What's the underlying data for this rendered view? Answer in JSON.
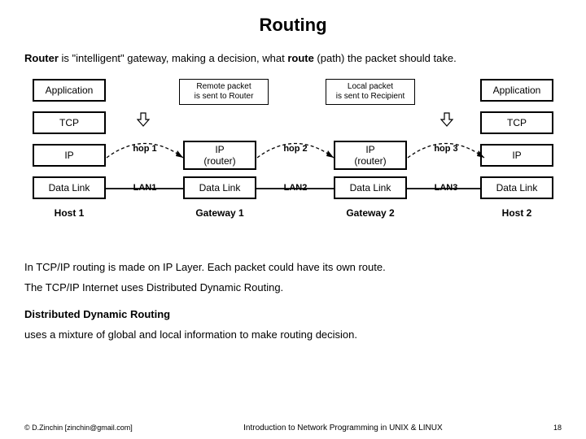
{
  "title": "Routing",
  "intro": {
    "prefix": "Router",
    "mid": " is \"intelligent\" gateway, making a decision, what ",
    "bold2": "route",
    "suffix": " (path) the packet should take."
  },
  "packets": {
    "remote": "Remote packet\nis sent to Router",
    "local": "Local packet\nis sent to Recipient"
  },
  "left_stack": {
    "app": "Application",
    "tcp": "TCP",
    "ip": "IP",
    "dl": "Data Link",
    "host": "Host 1"
  },
  "right_stack": {
    "app": "Application",
    "tcp": "TCP",
    "ip": "IP",
    "dl": "Data Link",
    "host": "Host 2"
  },
  "gw1": {
    "ip": "IP\n(router)",
    "dl": "Data Link",
    "label": "Gateway 1"
  },
  "gw2": {
    "ip": "IP\n(router)",
    "dl": "Data Link",
    "label": "Gateway 2"
  },
  "hops": {
    "h1": "hop 1",
    "h2": "hop 2",
    "h3": "hop 3"
  },
  "lans": {
    "l1": "LAN1",
    "l2": "LAN2",
    "l3": "LAN3"
  },
  "paras": {
    "p1": "In TCP/IP routing is made on IP Layer. Each packet could have its own route.",
    "p2": "The TCP/IP Internet uses Distributed Dynamic Routing.",
    "subhead": "Distributed Dynamic Routing",
    "p3": "uses a mixture of global and local information to make routing decision."
  },
  "footer": {
    "left": "© D.Zinchin [zinchin@gmail.com]",
    "mid": "Introduction to Network Programming in UNIX & LINUX",
    "right": "18"
  }
}
